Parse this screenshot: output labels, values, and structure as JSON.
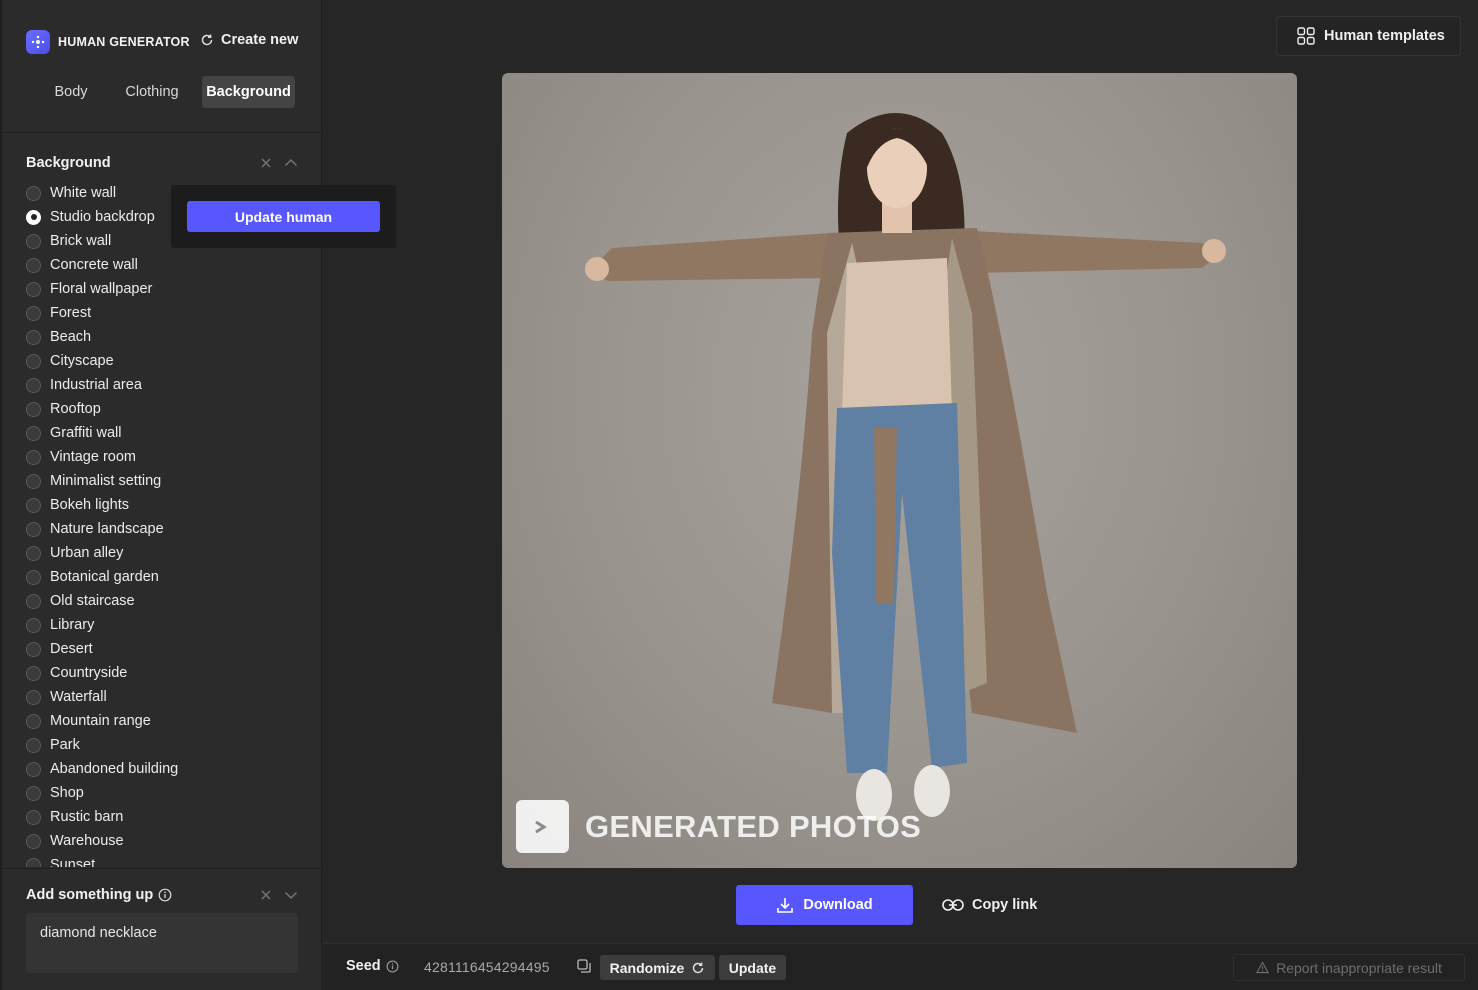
{
  "app": {
    "brand": "HUMAN GENERATOR",
    "create_new": "Create new"
  },
  "tabs": [
    {
      "label": "Body",
      "active": false
    },
    {
      "label": "Clothing",
      "active": false
    },
    {
      "label": "Background",
      "active": true
    }
  ],
  "background_section": {
    "title": "Background",
    "selected": "Studio backdrop",
    "options": [
      "White wall",
      "Studio backdrop",
      "Brick wall",
      "Concrete wall",
      "Floral wallpaper",
      "Forest",
      "Beach",
      "Cityscape",
      "Industrial area",
      "Rooftop",
      "Graffiti wall",
      "Vintage room",
      "Minimalist setting",
      "Bokeh lights",
      "Nature landscape",
      "Urban alley",
      "Botanical garden",
      "Old staircase",
      "Library",
      "Desert",
      "Countryside",
      "Waterfall",
      "Mountain range",
      "Park",
      "Abandoned building",
      "Shop",
      "Rustic barn",
      "Warehouse",
      "Sunset"
    ],
    "update_button": "Update human"
  },
  "add_section": {
    "title": "Add something up",
    "value": "diamond necklace"
  },
  "header": {
    "templates_label": "Human templates"
  },
  "image": {
    "watermark": "GENERATED PHOTOS",
    "icons": {
      "watermark_logo": "play-arrow-icon"
    }
  },
  "actions": {
    "download": "Download",
    "copy_link": "Copy link"
  },
  "bottom": {
    "seed_label": "Seed",
    "seed_value": "4281116454294495",
    "randomize": "Randomize",
    "update": "Update",
    "report": "Report inappropriate result"
  },
  "colors": {
    "accent": "#5856ff",
    "sidebar_bg": "#2b2b2b",
    "main_bg": "#262626"
  }
}
